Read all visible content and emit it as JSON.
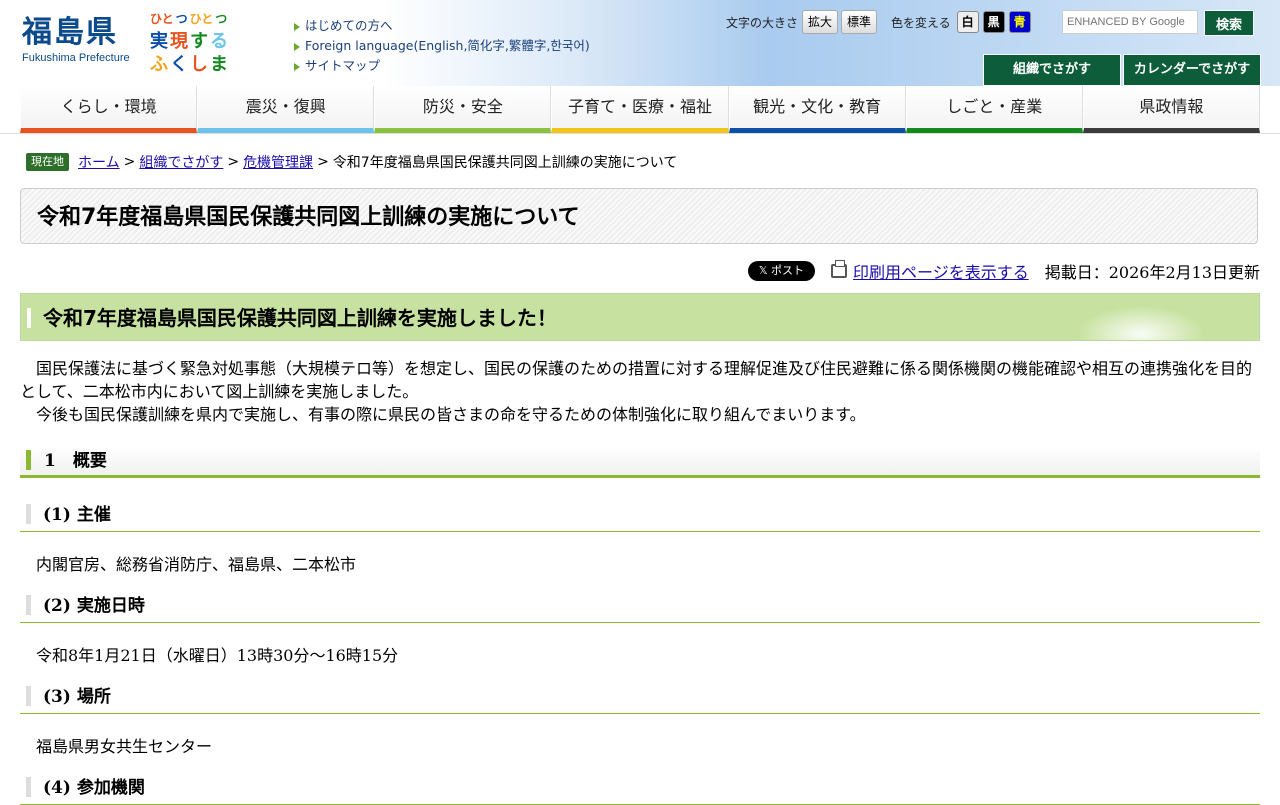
{
  "header": {
    "logo_jp": "福島県",
    "logo_en": "Fukushima Prefecture",
    "slogan_rows": [
      [
        "ひと",
        "つ",
        "ひと",
        "つ"
      ],
      [
        "実",
        "現",
        "す",
        "る"
      ],
      [
        "ふ",
        "く",
        "し",
        "ま"
      ]
    ],
    "links": [
      "はじめての方へ",
      "Foreign language(English,简化字,繁體字,한국어)",
      "サイトマップ"
    ],
    "font_size_label": "文字の大きさ",
    "font_large": "拡大",
    "font_standard": "標準",
    "color_label": "色を変える",
    "color_white": "白",
    "color_black": "黒",
    "color_blue": "青",
    "search_placeholder": "ENHANCED BY Google",
    "search_button": "検索",
    "org_search": "組織でさがす",
    "calendar_search": "カレンダーでさがす"
  },
  "nav": {
    "items": [
      {
        "label": "くらし・環境",
        "color": "#e8521e"
      },
      {
        "label": "震災・復興",
        "color": "#6cc4e8"
      },
      {
        "label": "防災・安全",
        "color": "#8cc13f"
      },
      {
        "label": "子育て・医療・福祉",
        "color": "#f2c31a"
      },
      {
        "label": "観光・文化・教育",
        "color": "#0d4ea6"
      },
      {
        "label": "しごと・産業",
        "color": "#128a1e"
      },
      {
        "label": "県政情報",
        "color": "#3b3b3b"
      }
    ]
  },
  "breadcrumb": {
    "here": "現在地",
    "home": "ホーム",
    "org": "組織でさがす",
    "dept": "危機管理課",
    "current": "令和7年度福島県国民保護共同図上訓練の実施について"
  },
  "page": {
    "title": "令和7年度福島県国民保護共同図上訓練の実施について",
    "x_post": "𝕏 ポスト",
    "print_link": "印刷用ページを表示する",
    "date": "掲載日：2026年2月13日更新",
    "heading": "令和7年度福島県国民保護共同図上訓練を実施しました！",
    "para1": "　国民保護法に基づく緊急対処事態（大規模テロ等）を想定し、国民の保護のための措置に対する理解促進及び住民避難に係る関係機関の機能確認や相互の連携強化を目的として、二本松市内において図上訓練を実施しました。",
    "para2": "　今後も国民保護訓練を県内で実施し、有事の際に県民の皆さまの命を守るための体制強化に取り組んでまいります。",
    "section1": "1　概要",
    "sub1_title": "(1) 主催",
    "sub1_text": "内閣官房、総務省消防庁、福島県、二本松市",
    "sub2_title": "(2) 実施日時",
    "sub2_text": "令和8年1月21日（水曜日）13時30分～16時15分",
    "sub3_title": "(3) 場所",
    "sub3_text": "福島県男女共生センター",
    "sub4_title": "(4) 参加機関"
  }
}
